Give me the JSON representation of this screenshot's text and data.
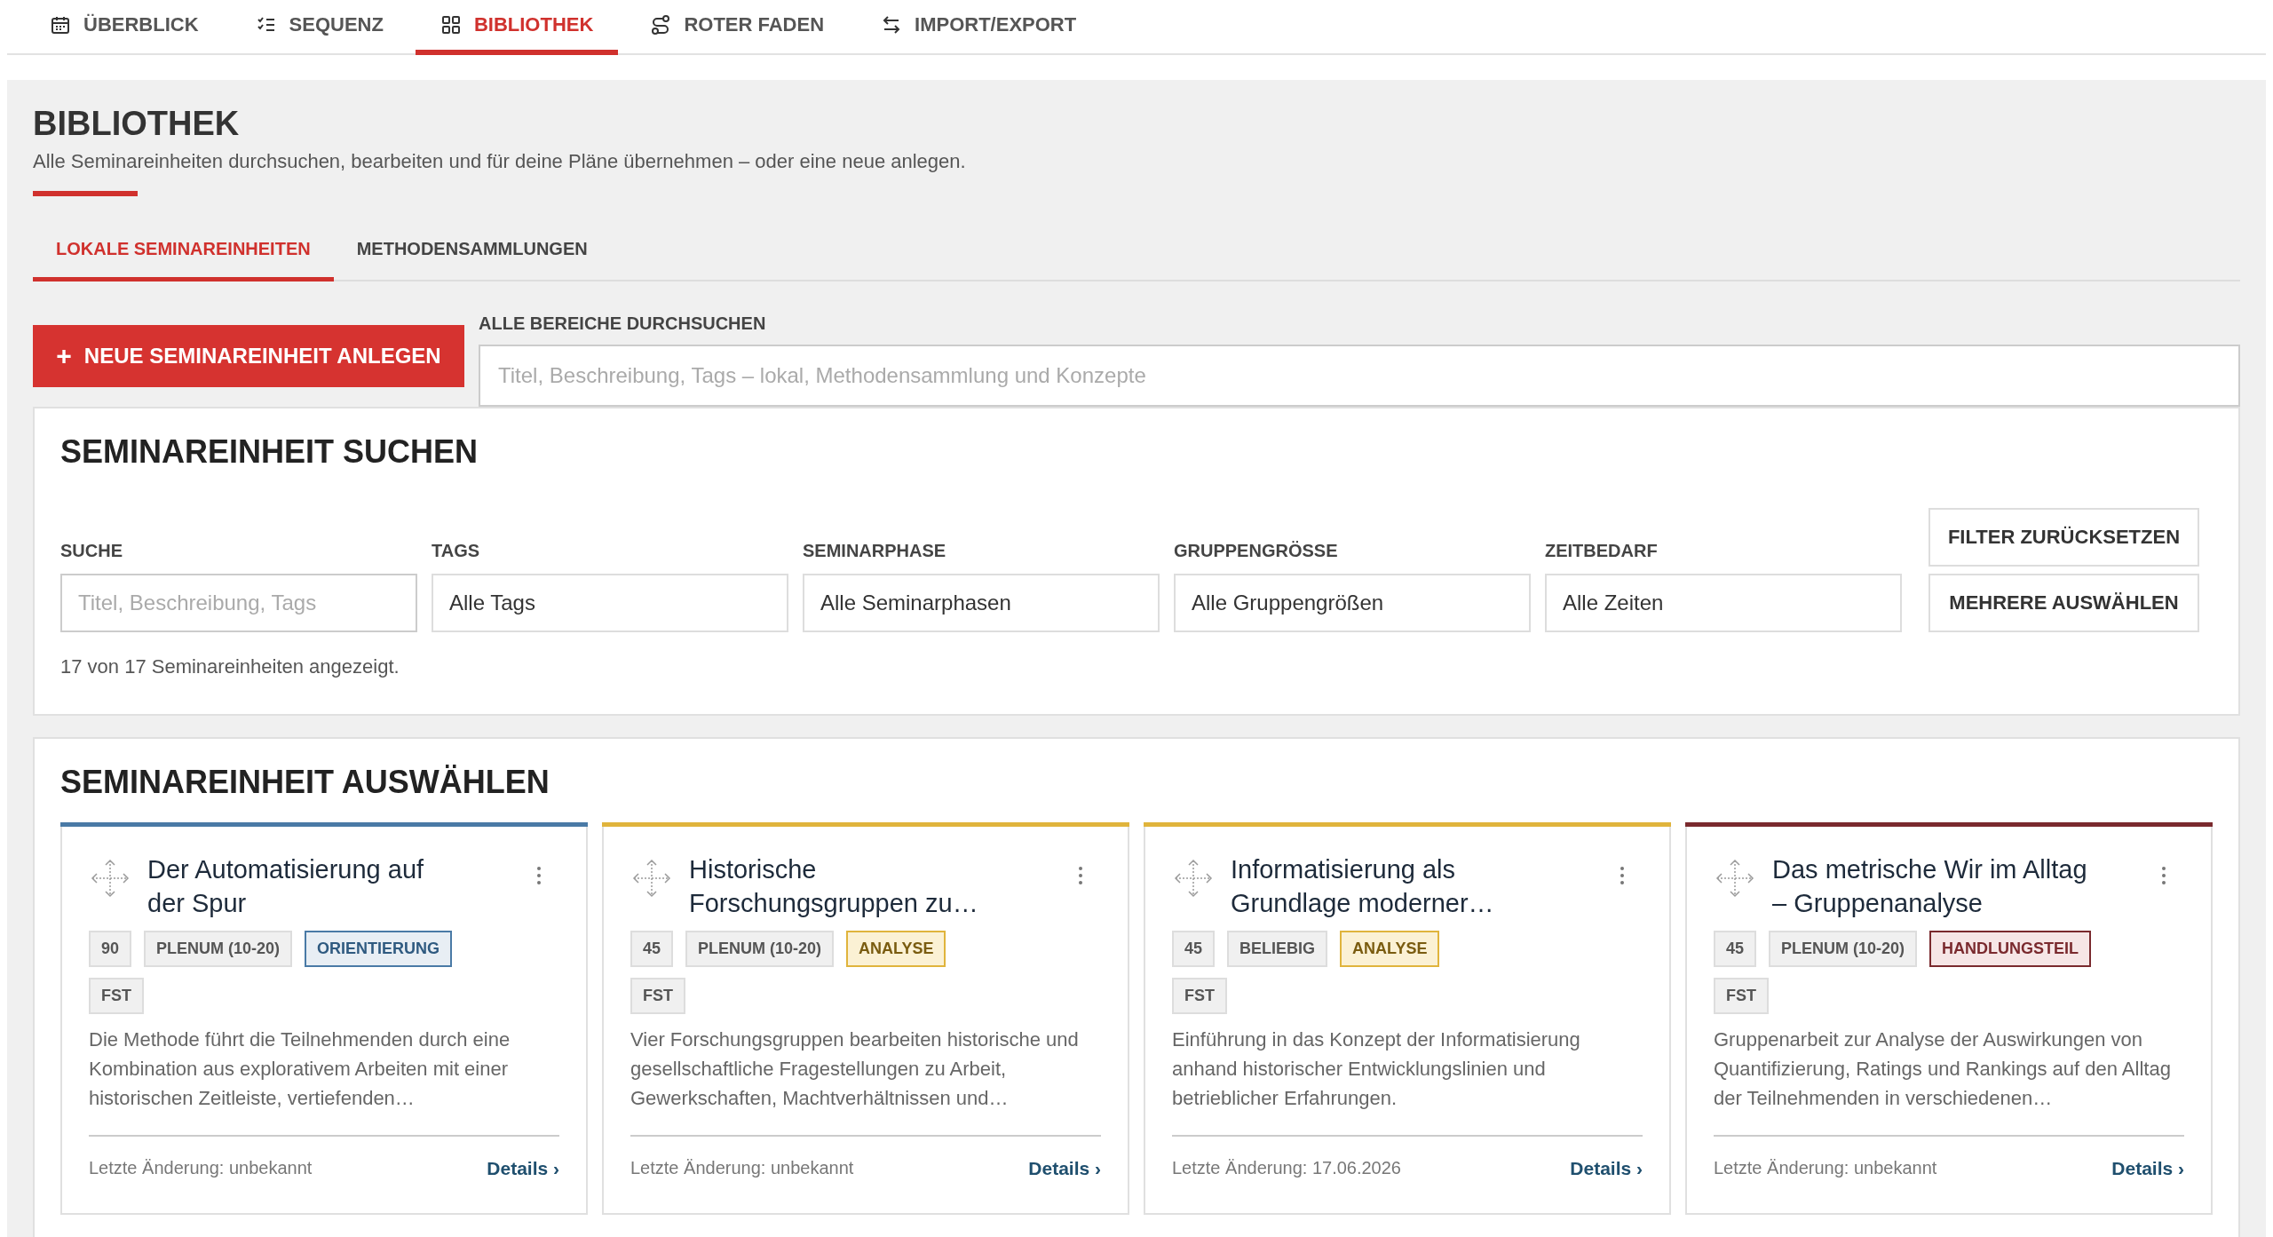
{
  "nav_tabs": [
    {
      "label": "ÜBERBLICK",
      "selected": false
    },
    {
      "label": "SEQUENZ",
      "selected": false
    },
    {
      "label": "BIBLIOTHEK",
      "selected": true
    },
    {
      "label": "ROTER FADEN",
      "selected": false
    },
    {
      "label": "IMPORT/EXPORT",
      "selected": false
    }
  ],
  "page": {
    "title": "BIBLIOTHEK",
    "subtitle": "Alle Seminareinheiten durchsuchen, bearbeiten und für deine Pläne übernehmen – oder eine neue anlegen."
  },
  "sub_tabs": [
    {
      "label": "LOKALE SEMINAREINHEITEN",
      "selected": true
    },
    {
      "label": "METHODENSAMMLUNGEN",
      "selected": false
    }
  ],
  "new_button": {
    "icon": "+",
    "label": "NEUE SEMINAREINHEIT ANLEGEN"
  },
  "global_search": {
    "label": "ALLE BEREICHE DURCHSUCHEN",
    "placeholder": "Titel, Beschreibung, Tags – lokal, Methodensammlung und Konzepte"
  },
  "search_panel": {
    "title": "SEMINAREINHEIT SUCHEN",
    "filters": [
      {
        "label": "SUCHE",
        "kind": "text",
        "placeholder": "Titel, Beschreibung, Tags"
      },
      {
        "label": "TAGS",
        "kind": "select",
        "value": "Alle Tags"
      },
      {
        "label": "SEMINARPHASE",
        "kind": "select",
        "value": "Alle Seminarphasen"
      },
      {
        "label": "GRUPPENGRÖSSE",
        "kind": "select",
        "value": "Alle Gruppengrößen"
      },
      {
        "label": "ZEITBEDARF",
        "kind": "select",
        "value": "Alle Zeiten"
      }
    ],
    "buttons": [
      "FILTER ZURÜCKSETZEN",
      "MEHRERE AUSWÄHLEN"
    ],
    "result_count": "17 von 17 Seminareinheiten angezeigt."
  },
  "select_panel": {
    "title": "SEMINAREINHEIT AUSWÄHLEN",
    "cards": [
      {
        "title": "Der Automatisierung auf der Spur",
        "color": "#4a7aa6",
        "tags": [
          "90",
          "PLENUM (10-20)"
        ],
        "phase": "ORIENTIERUNG",
        "extra_tags": [
          "FST"
        ],
        "description": "Die Methode führt die Teilnehmenden durch eine Kombination aus explorativem Arbeiten mit einer historischen Zeitleiste, vertiefenden…",
        "modified": "Letzte Änderung: unbekannt",
        "details": "Details ›"
      },
      {
        "title": "Historische Forschungsgruppen zu…",
        "color": "#e0b43c",
        "tags": [
          "45",
          "PLENUM (10-20)"
        ],
        "phase": "ANALYSE",
        "extra_tags": [
          "FST"
        ],
        "description": "Vier Forschungsgruppen bearbeiten historische und gesellschaftliche Fragestellungen zu Arbeit, Gewerkschaften, Machtverhältnissen und…",
        "modified": "Letzte Änderung: unbekannt",
        "details": "Details ›"
      },
      {
        "title": "Informatisierung als Grundlage moderner…",
        "color": "#e0b43c",
        "tags": [
          "45",
          "BELIEBIG"
        ],
        "phase": "ANALYSE",
        "extra_tags": [
          "FST"
        ],
        "description": "Einführung in das Konzept der Informatisierung anhand historischer Entwicklungslinien und betrieblicher Erfahrungen.",
        "modified": "Letzte Änderung: 17.06.2026",
        "details": "Details ›"
      },
      {
        "title": "Das metrische Wir im Alltag – Gruppenanalyse",
        "color": "#7a2a2e",
        "tags": [
          "45",
          "PLENUM (10-20)"
        ],
        "phase": "HANDLUNGSTEIL",
        "extra_tags": [
          "FST"
        ],
        "description": "Gruppenarbeit zur Analyse der Auswirkungen von Quantifizierung, Ratings und Rankings auf den Alltag der Teilnehmenden in verschiedenen…",
        "modified": "Letzte Änderung: unbekannt",
        "details": "Details ›"
      }
    ]
  }
}
